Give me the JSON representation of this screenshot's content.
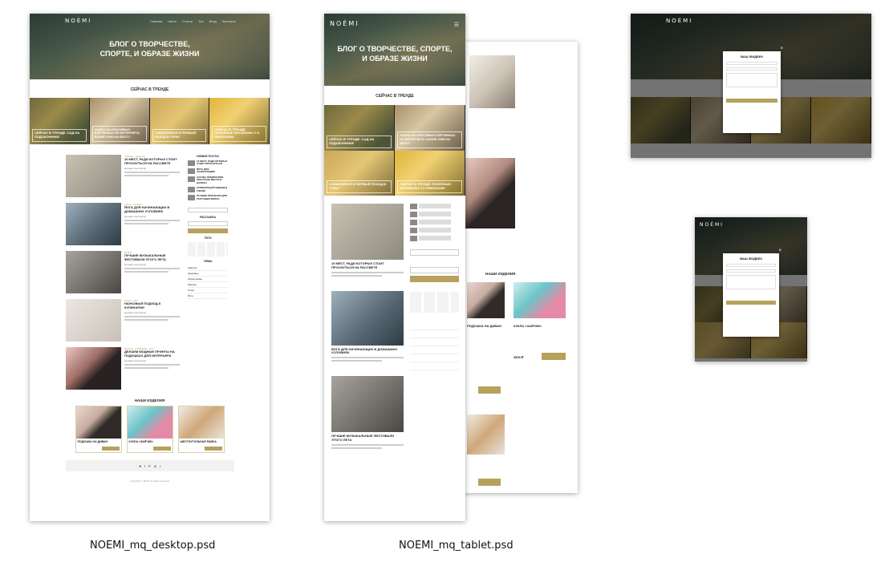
{
  "brand": {
    "name": "NOÉMI"
  },
  "desktop": {
    "nav": [
      "Главная",
      "Части",
      "Статьи",
      "Тип",
      "Вход",
      "Контакты"
    ],
    "hero_title": "БЛОГ О ТВОРЧЕСТВЕ, СПОРТЕ, И ОБРАЗЕ ЖИЗНИ",
    "trending": "СЕЙЧАС В ТРЕНДЕ",
    "tiles": [
      "СЕЙЧАС В ТРЕНДЕ: САД НА ПОДОКОННИКЕ",
      "СЫРЫ НА КРАСИВЫХ КАРТИНКАХ ИЗ ИНТЕРНЕТА: КАКИЕ ОНИ НА ВКУС?",
      "СОБИРАЕМСЯ В ПЕРВЫЙ ПОХОД В ГОРЫ",
      "СЕЙЧАС В ТРЕНДЕ: ПОЛЕЗНЫЕ ВИТАМИНЫ С 8 ЛИМОНАМИ"
    ],
    "posts": [
      {
        "tags": "TRAVEL · HEALTH",
        "title": "10 МЕСТ, РАДИ КОТОРЫХ СТОИТ ПРОСНУТЬСЯ НА РАССВЕТЕ",
        "meta": "Неизвестный автор"
      },
      {
        "tags": "YOGA · SPORT",
        "title": "ЙОГА ДЛЯ НАЧИНАЮЩИХ В ДОМАШНИХ УСЛОВИЯХ",
        "meta": "Неизвестный автор"
      },
      {
        "tags": "MUSIC",
        "title": "ЛУЧШИЕ МУЗЫКАЛЬНЫЕ ФЕСТИВАЛИ ЭТОГО ЛЕТА",
        "meta": "Неизвестный автор"
      },
      {
        "tags": "FOOD · ART",
        "title": "НАУКОВЫЙ ПОДХОД К КУЛИНАРИИ",
        "meta": "Неизвестный автор"
      },
      {
        "tags": "DECOR · INTERIOR · ART",
        "title": "ДЕЛАЕМ МОДНЫЕ ПРИНТЫ НА ПОДУШКАХ ДЛЯ ИНТЕРЬЕРА",
        "meta": "Неизвестный автор"
      }
    ],
    "sidebar_new": "НОВЫЕ ПОСТЫ",
    "sidebar_posts": [
      "10 МЕСТ, РАДИ КОТОРЫХ СТОИТ ПРОСНУТЬСЯ",
      "ЙОГА ДЛЯ НАЧИНАЮЩИХ",
      "КАК МЫ ПРЕВРАТИЛИ КЛАССНОЕ МЕСТО В БАЛКОН",
      "КУЛИНАРНЫЙ ПОДХОД В УЖИНЕ",
      "ЛУЧШИЕ ПРИЧЕСКИ ДЛЯ РАСТУЩИХ ВОЛОС"
    ],
    "newsletter": "РАССЫЛКА",
    "tags_h": "ТЕГИ",
    "topics_h": "ТЕМЫ",
    "categories": [
      "Красота",
      "Здоровье",
      "Образ жизни",
      "Музыка",
      "Спорт",
      "Йога"
    ],
    "products_h": "НАШИ ИЗДЕЛИЯ",
    "products": [
      "ПОДУШКА НА ДИВАН",
      "КУКЛА «ЗАЙЧИК»",
      "ШЕСТИУГОЛЬНАЯ РАМКА"
    ],
    "social": [
      "♥",
      "f",
      "P",
      "◎",
      "t"
    ],
    "copyright": "Copyright © 2018. All rights reserved"
  },
  "tablet": {
    "hero_title": "БЛОГ О ТВОРЧЕСТВЕ, СПОРТЕ, И ОБРАЗЕ ЖИЗНИ",
    "trending": "СЕЙЧАС В ТРЕНДЕ",
    "tiles": [
      "СЕЙЧАС В ТРЕНДЕ: САД НА ПОДОКОННИКЕ",
      "СЫРЫ НА КРАСИВЫХ КАРТИНКАХ ИЗ ИНТЕРНЕТА: КАКИЕ ОНИ НА ВКУС?",
      "СОБИРАЕМСЯ В ПЕРВЫЙ ПОХОД В ГОРЫ",
      "СЕЙЧАС В ТРЕНДЕ: ПОЛЕЗНЫЕ ВИТАМИНЫ С 8 ЛИМОНАМИ"
    ],
    "posts": [
      {
        "title": "10 МЕСТ, РАДИ КОТОРЫХ СТОИТ ПРОСНУТЬСЯ НА РАССВЕТЕ"
      },
      {
        "title": "ЙОГА ДЛЯ НАЧИНАЮЩИХ В ДОМАШНИХ УСЛОВИЯХ"
      },
      {
        "title": "ЛУЧШИЕ МУЗЫКАЛЬНЫЕ ФЕСТИВАЛИ ЭТОГО ЛЕТА"
      }
    ],
    "products_h": "НАШИ ИЗДЕЛИЯ",
    "back_products": [
      "ПОДУШКА НА ДИВАН",
      "КУКЛА «ЗАЙЧИК»"
    ],
    "back_prices": [
      "3500 ₽"
    ]
  },
  "modal": {
    "title": "ВАШ ФИДБЕК",
    "button": "ОТПРАВИТЬ"
  },
  "labels": {
    "desktop": "NOEMI_mq_desktop.psd",
    "tablet": "NOEMI_mq_tablet.psd"
  }
}
